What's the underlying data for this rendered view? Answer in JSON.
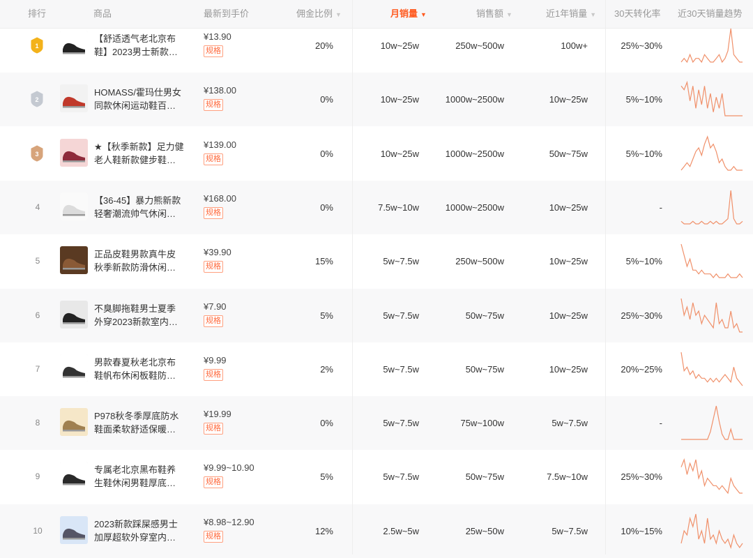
{
  "header": {
    "rank": "排行",
    "product": "商品",
    "price": "最新到手价",
    "commission": "佣金比例",
    "monthly_sales": "月销量",
    "sales_amount": "销售额",
    "year_sales": "近1年销量",
    "conversion": "30天转化率",
    "trend": "近30天销量趋势"
  },
  "colors": {
    "accent": "#ff5a1f",
    "spark": "#f0906a",
    "gold": "#f3b21b",
    "silver": "#c4c9d1",
    "bronze": "#d7a47b"
  },
  "rows": [
    {
      "rank": "1",
      "medal": "gold",
      "thumb": "shoe-black",
      "name1": "【舒适透气老北京布",
      "name2": "鞋】2023男士新款…",
      "price": "¥13.90",
      "spec": "规格",
      "commission": "20%",
      "monthly": "10w~25w",
      "amount": "250w~500w",
      "year": "100w+",
      "conversion": "25%~30%",
      "trend": [
        3,
        4,
        3,
        5,
        3,
        4,
        4,
        3,
        5,
        4,
        3,
        3,
        4,
        5,
        3,
        4,
        6,
        12,
        5,
        4,
        3,
        3
      ]
    },
    {
      "rank": "2",
      "medal": "silver",
      "thumb": "shoe-white-color",
      "name1": "HOMASS/霍玛仕男女",
      "name2": "同款休闲运动鞋百…",
      "price": "¥138.00",
      "spec": "规格",
      "commission": "0%",
      "monthly": "10w~25w",
      "amount": "1000w~2500w",
      "year": "10w~25w",
      "conversion": "5%~10%",
      "trend": [
        9,
        8,
        10,
        5,
        9,
        3,
        8,
        4,
        9,
        3,
        7,
        2,
        6,
        3,
        7,
        1,
        1,
        1,
        1,
        1,
        1,
        1
      ]
    },
    {
      "rank": "3",
      "medal": "bronze",
      "thumb": "shoe-red",
      "name1": "★【秋季新款】足力健",
      "name2": "老人鞋新款健步鞋…",
      "price": "¥139.00",
      "spec": "规格",
      "commission": "0%",
      "monthly": "10w~25w",
      "amount": "1000w~2500w",
      "year": "50w~75w",
      "conversion": "5%~10%",
      "trend": [
        1,
        2,
        3,
        2,
        4,
        6,
        7,
        5,
        8,
        10,
        7,
        8,
        6,
        3,
        4,
        2,
        1,
        1,
        2,
        1,
        1,
        1
      ]
    },
    {
      "rank": "4",
      "medal": "",
      "thumb": "shoe-white",
      "name1": "【36-45】暴力熊新款",
      "name2": "轻奢潮流帅气休闲…",
      "price": "¥168.00",
      "spec": "规格",
      "commission": "0%",
      "monthly": "7.5w~10w",
      "amount": "1000w~2500w",
      "year": "10w~25w",
      "conversion": "-",
      "trend": [
        2,
        1,
        1,
        1,
        2,
        1,
        1,
        2,
        1,
        1,
        2,
        1,
        2,
        1,
        1,
        2,
        3,
        14,
        3,
        1,
        1,
        2
      ]
    },
    {
      "rank": "5",
      "medal": "",
      "thumb": "shoe-brown",
      "name1": "正品皮鞋男款真牛皮",
      "name2": "秋季新款防滑休闲…",
      "price": "¥39.90",
      "spec": "规格",
      "commission": "15%",
      "monthly": "5w~7.5w",
      "amount": "250w~500w",
      "year": "10w~25w",
      "conversion": "5%~10%",
      "trend": [
        10,
        7,
        4,
        6,
        3,
        3,
        2,
        3,
        2,
        2,
        2,
        1,
        2,
        1,
        1,
        1,
        2,
        1,
        1,
        1,
        2,
        1
      ]
    },
    {
      "rank": "6",
      "medal": "",
      "thumb": "slipper-black",
      "name1": "不臭脚拖鞋男士夏季",
      "name2": "外穿2023新款室内…",
      "price": "¥7.90",
      "spec": "规格",
      "commission": "5%",
      "monthly": "5w~7.5w",
      "amount": "50w~75w",
      "year": "10w~25w",
      "conversion": "25%~30%",
      "trend": [
        9,
        5,
        7,
        4,
        8,
        5,
        6,
        3,
        5,
        4,
        3,
        2,
        8,
        3,
        4,
        2,
        2,
        6,
        2,
        3,
        1,
        1
      ]
    },
    {
      "rank": "7",
      "medal": "",
      "thumb": "shoe-black-promo",
      "name1": "男款春夏秋老北京布",
      "name2": "鞋帆布休闲板鞋防…",
      "price": "¥9.99",
      "spec": "规格",
      "commission": "2%",
      "monthly": "5w~7.5w",
      "amount": "50w~75w",
      "year": "10w~25w",
      "conversion": "20%~25%",
      "trend": [
        10,
        5,
        6,
        4,
        5,
        3,
        4,
        3,
        3,
        2,
        3,
        2,
        3,
        2,
        3,
        4,
        3,
        2,
        6,
        3,
        2,
        1
      ]
    },
    {
      "rank": "8",
      "medal": "",
      "thumb": "shoe-beige",
      "name1": "P978秋冬季厚底防水",
      "name2": "鞋面柔软舒适保暖…",
      "price": "¥19.99",
      "spec": "规格",
      "commission": "0%",
      "monthly": "5w~7.5w",
      "amount": "75w~100w",
      "year": "5w~7.5w",
      "conversion": "-",
      "trend": [
        1,
        1,
        1,
        1,
        1,
        1,
        1,
        1,
        1,
        1,
        4,
        9,
        14,
        8,
        3,
        1,
        1,
        5,
        1,
        1,
        1,
        1
      ]
    },
    {
      "rank": "9",
      "medal": "",
      "thumb": "shoe-black-red",
      "name1": "专属老北京黑布鞋养",
      "name2": "生鞋休闲男鞋厚底…",
      "price": "¥9.99~10.90",
      "spec": "规格",
      "commission": "5%",
      "monthly": "5w~7.5w",
      "amount": "50w~75w",
      "year": "7.5w~10w",
      "conversion": "25%~30%",
      "trend": [
        8,
        10,
        6,
        9,
        7,
        10,
        5,
        7,
        3,
        5,
        4,
        3,
        3,
        2,
        3,
        2,
        1,
        5,
        3,
        2,
        1,
        1
      ]
    },
    {
      "rank": "10",
      "medal": "",
      "thumb": "shoe-grey-box",
      "name1": "2023新款踩屎感男士",
      "name2": "加厚超软外穿室内…",
      "price": "¥8.98~12.90",
      "spec": "规格",
      "commission": "12%",
      "monthly": "2.5w~5w",
      "amount": "25w~50w",
      "year": "5w~7.5w",
      "conversion": "10%~15%",
      "trend": [
        3,
        6,
        5,
        9,
        7,
        10,
        4,
        6,
        3,
        9,
        4,
        5,
        3,
        6,
        4,
        3,
        4,
        2,
        5,
        3,
        2,
        3
      ]
    }
  ]
}
